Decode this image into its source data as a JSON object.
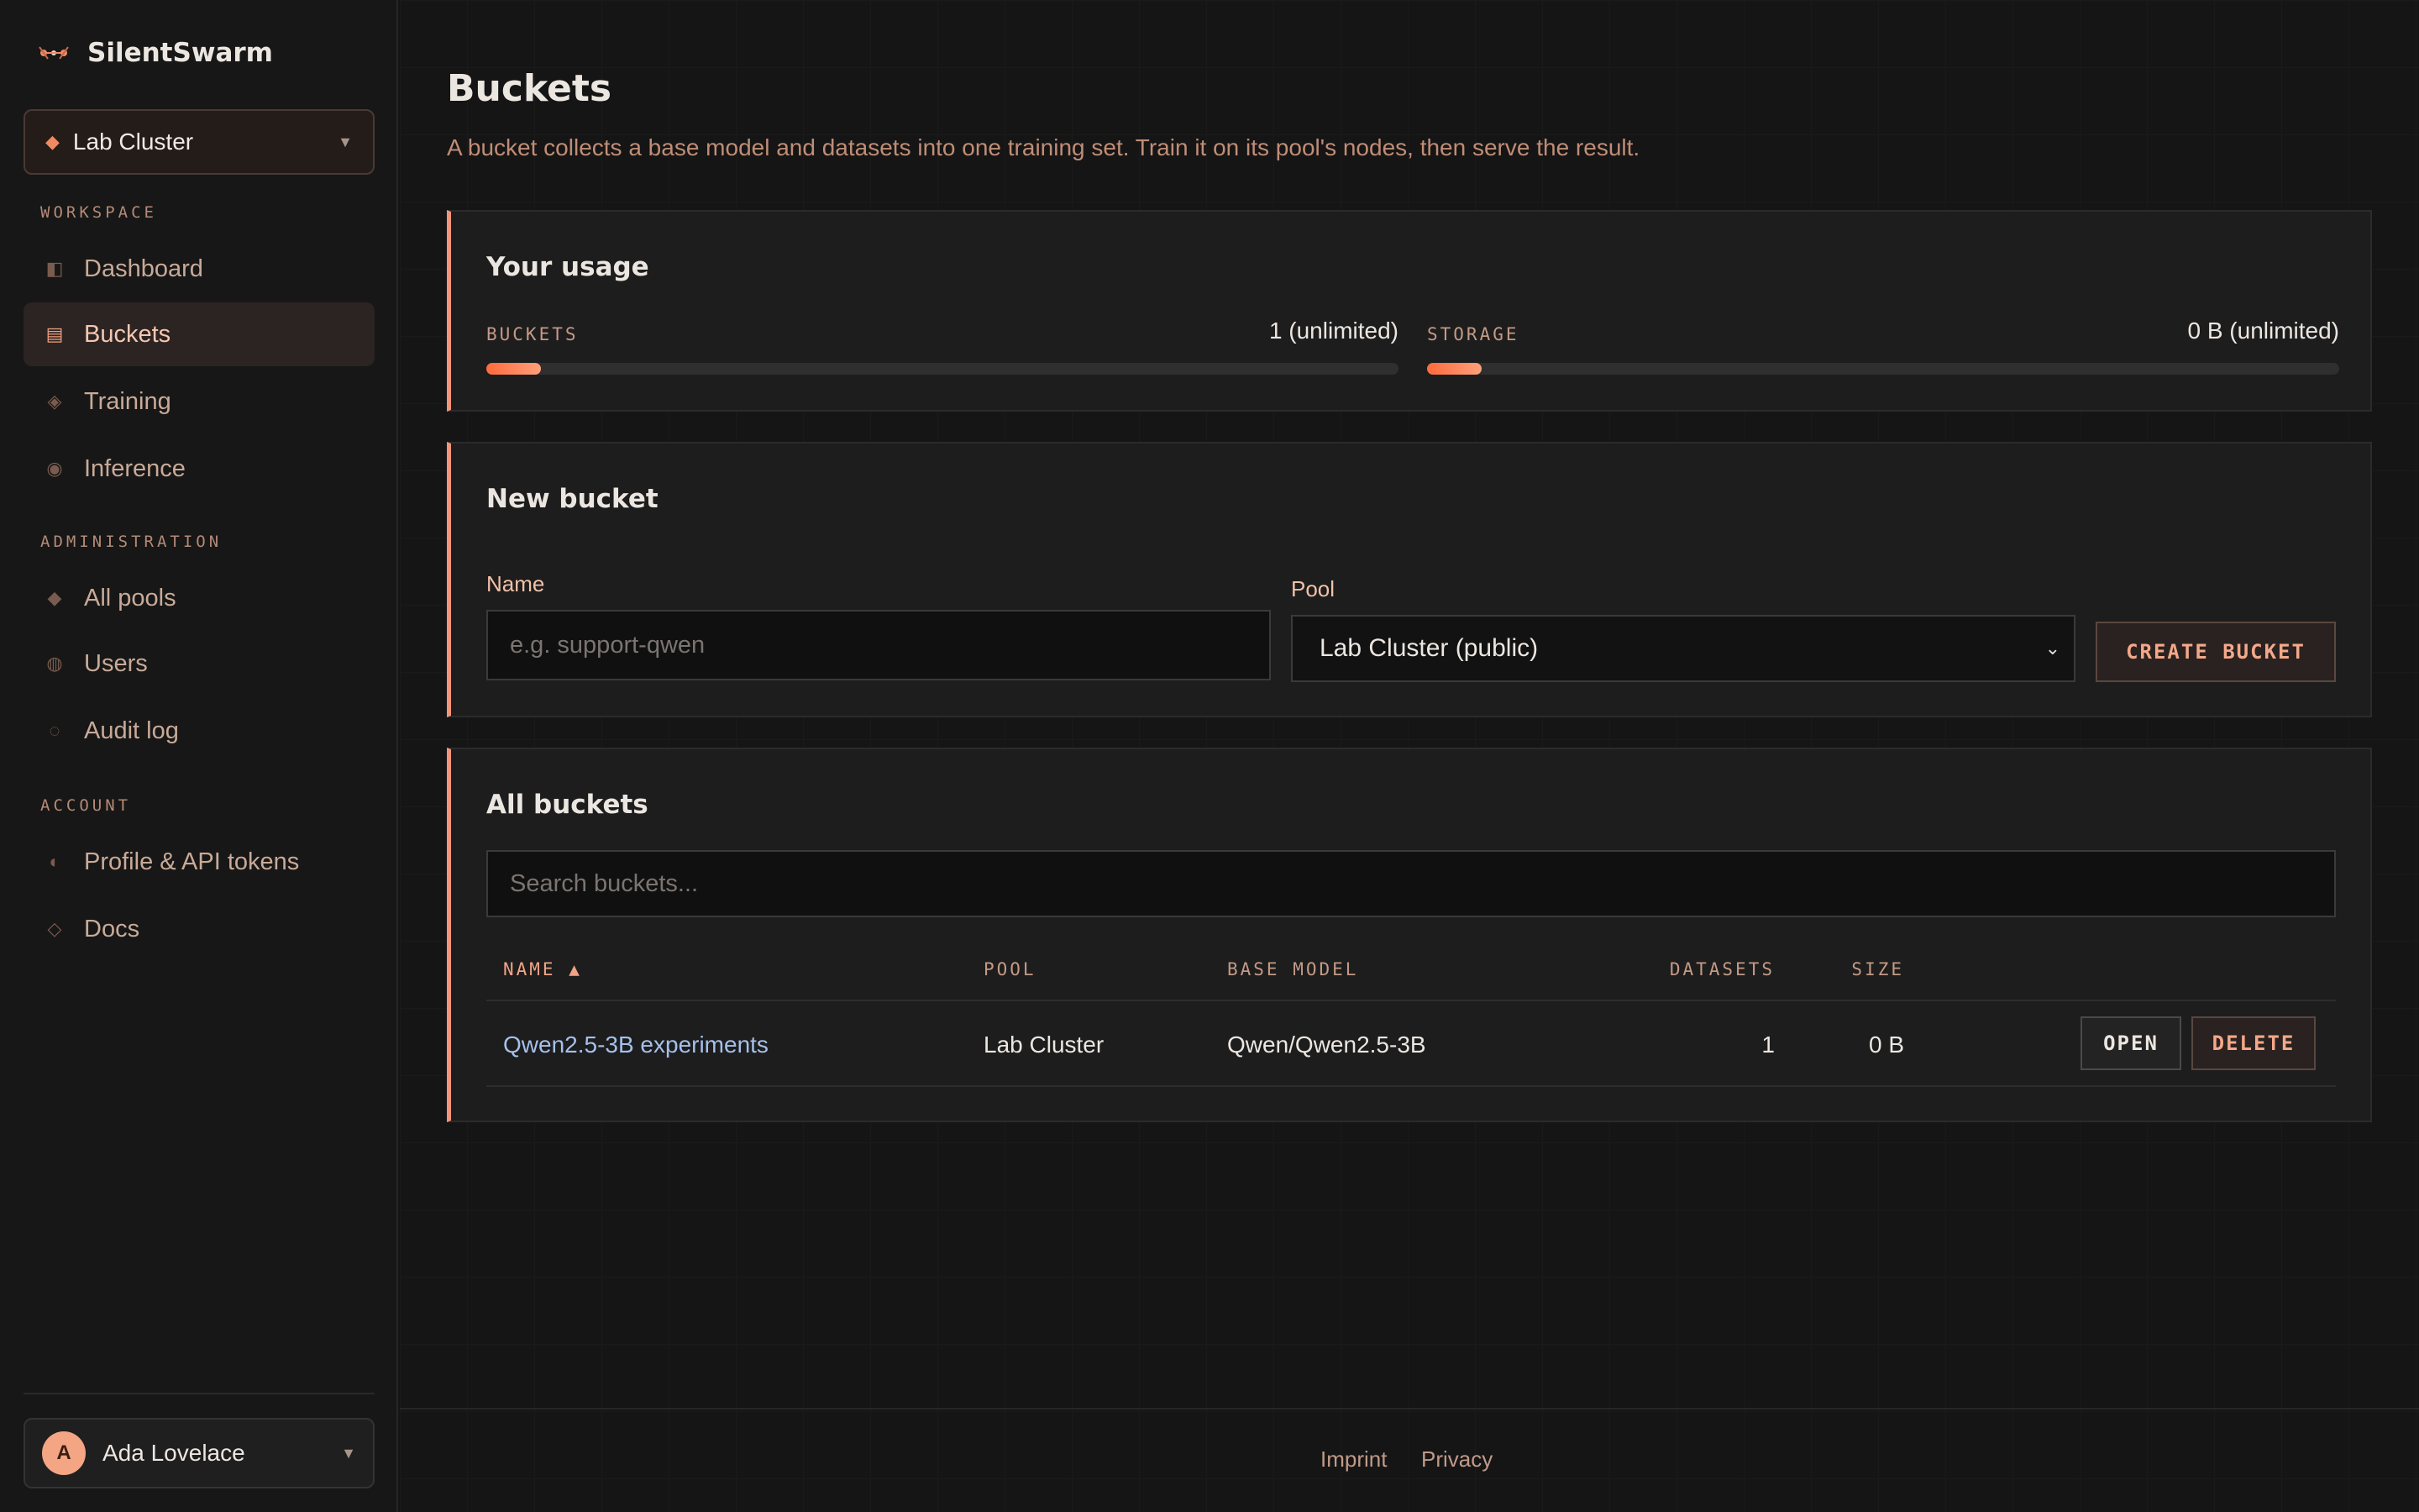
{
  "app": {
    "name": "SilentSwarm"
  },
  "cluster_selector": {
    "label": "Lab Cluster"
  },
  "sidebar": {
    "sections": {
      "workspace": "WORKSPACE",
      "administration": "ADMINISTRATION",
      "account": "ACCOUNT"
    },
    "items": [
      {
        "label": "Dashboard",
        "icon": "dashboard-icon"
      },
      {
        "label": "Buckets",
        "icon": "bucket-icon",
        "active": true
      },
      {
        "label": "Training",
        "icon": "training-icon"
      },
      {
        "label": "Inference",
        "icon": "inference-icon"
      },
      {
        "label": "All pools",
        "icon": "pools-icon"
      },
      {
        "label": "Users",
        "icon": "users-icon"
      },
      {
        "label": "Audit log",
        "icon": "audit-log-icon"
      },
      {
        "label": "Profile & API tokens",
        "icon": "profile-icon"
      },
      {
        "label": "Docs",
        "icon": "docs-icon"
      }
    ]
  },
  "user": {
    "initial": "A",
    "name": "Ada Lovelace"
  },
  "page": {
    "title": "Buckets",
    "subtitle": "A bucket collects a base model and datasets into one training set. Train it on its pool's nodes, then serve the result."
  },
  "usage": {
    "title": "Your usage",
    "buckets": {
      "label": "BUCKETS",
      "value": "1 (unlimited)",
      "fill_fraction": 0.06
    },
    "storage": {
      "label": "STORAGE",
      "value": "0 B (unlimited)",
      "fill_fraction": 0.06
    }
  },
  "new_bucket": {
    "title": "New bucket",
    "name_label": "Name",
    "name_placeholder": "e.g. support-qwen",
    "pool_label": "Pool",
    "pool_value": "Lab Cluster (public)",
    "create_label": "CREATE BUCKET"
  },
  "all_buckets": {
    "title": "All buckets",
    "search_placeholder": "Search buckets...",
    "columns": {
      "name": "NAME ▲",
      "pool": "POOL",
      "base_model": "BASE MODEL",
      "datasets": "DATASETS",
      "size": "SIZE"
    },
    "rows": [
      {
        "name": "Qwen2.5-3B experiments",
        "pool": "Lab Cluster",
        "base_model": "Qwen/Qwen2.5-3B",
        "datasets": "1",
        "size": "0 B",
        "open_label": "OPEN",
        "delete_label": "DELETE"
      }
    ]
  },
  "footer": {
    "imprint": "Imprint",
    "privacy": "Privacy"
  },
  "colors": {
    "accent": "#f3957a",
    "background": "#151515",
    "link": "#a5c0ea"
  }
}
